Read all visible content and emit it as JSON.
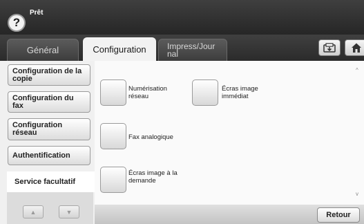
{
  "header": {
    "help_glyph": "?",
    "status": "Prêt",
    "help_icon": "question-icon"
  },
  "tabs": [
    {
      "label": "Général",
      "active": false
    },
    {
      "label": "Configuration",
      "active": true
    },
    {
      "label": "Impress/Jour nal",
      "line1": "Impress/Jour",
      "line2": "nal",
      "active": false
    }
  ],
  "toolbar": {
    "copy_icon": "copy-job-icon",
    "home_icon": "home-icon"
  },
  "sidebar": {
    "items": [
      {
        "label": "Configuration de la copie",
        "selected": false
      },
      {
        "label": "Configuration du fax",
        "selected": false
      },
      {
        "label": "Configuration réseau",
        "selected": false
      },
      {
        "label": "Authentification",
        "selected": false
      },
      {
        "label": "Service facultatif",
        "selected": true
      }
    ],
    "up_glyph": "▲",
    "down_glyph": "▼"
  },
  "options": [
    {
      "line1": "Numérisation",
      "line2": "réseau"
    },
    {
      "line1": "Écras image",
      "line2": "immédiat"
    },
    {
      "line1": "Fax analogique",
      "line2": ""
    },
    {
      "line1": "Écras image à la",
      "line2": "demande"
    }
  ],
  "scrollbar": {
    "up_glyph": "^",
    "down_glyph": "v"
  },
  "footer": {
    "back_label": "Retour"
  },
  "colors": {
    "header_bg": "#2e2e2e",
    "panel_bg": "#fafafa",
    "accent_text": "#222222"
  }
}
